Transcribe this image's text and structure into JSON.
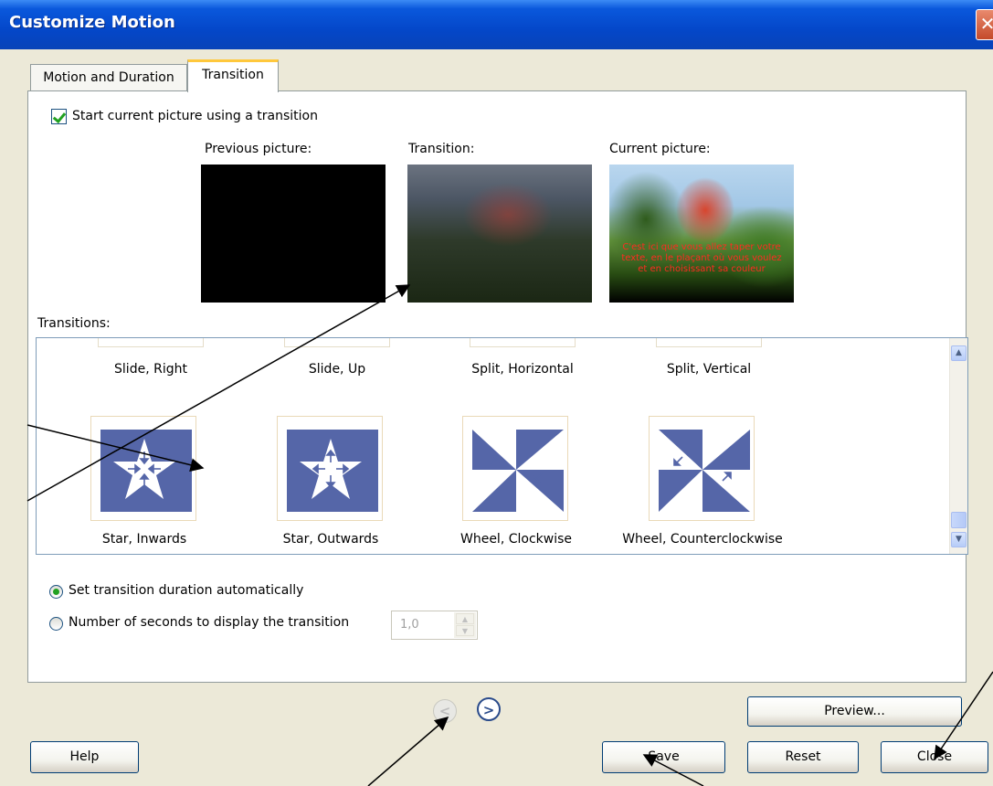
{
  "window": {
    "title": "Customize Motion",
    "close_glyph": "✕"
  },
  "tabs": [
    {
      "label": "Motion and Duration",
      "selected": false
    },
    {
      "label": "Transition",
      "selected": true
    }
  ],
  "transition_panel": {
    "start_checkbox_label": "Start current picture using a transition",
    "start_checkbox_checked": true,
    "previous_label": "Previous picture:",
    "transition_label": "Transition:",
    "current_label": "Current picture:",
    "current_picture_caption": "C'est ici que vous allez taper votre texte, en le plaçant où vous voulez et en choisissant sa couleur",
    "transitions_label": "Transitions:",
    "transitions": [
      {
        "label": "Slide, Right",
        "icon": "partial-thumbnail"
      },
      {
        "label": "Slide, Up",
        "icon": "partial-thumbnail"
      },
      {
        "label": "Split, Horizontal",
        "icon": "partial-thumbnail"
      },
      {
        "label": "Split, Vertical",
        "icon": "partial-thumbnail"
      },
      {
        "label": "Star, Inwards",
        "icon": "star-inwards-icon"
      },
      {
        "label": "Star, Outwards",
        "icon": "star-outwards-icon"
      },
      {
        "label": "Wheel, Clockwise",
        "icon": "wheel-clockwise-icon"
      },
      {
        "label": "Wheel, Counterclockwise",
        "icon": "wheel-counterclockwise-icon"
      }
    ],
    "duration_auto_label": "Set transition duration automatically",
    "duration_auto_selected": true,
    "duration_seconds_label": "Number of seconds to display the transition",
    "duration_seconds_value": "1,0"
  },
  "buttons": {
    "help": "Help",
    "preview": "Preview...",
    "save": "Save",
    "reset": "Reset",
    "close": "Close",
    "prev_glyph": "<",
    "next_glyph": ">"
  },
  "colors": {
    "titlebar": "#0a58dc",
    "dialog_bg": "#ECE9D8",
    "tile_blue": "#5566a8",
    "check_green": "#21a121",
    "caption_red": "#ff2b20"
  }
}
